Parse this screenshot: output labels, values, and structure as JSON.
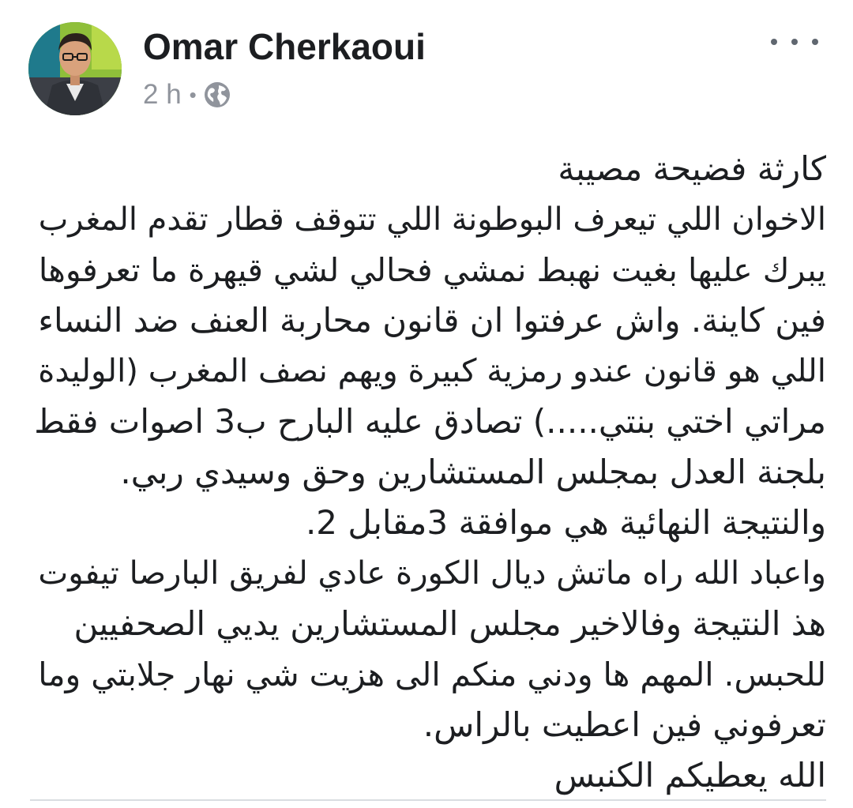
{
  "post": {
    "author": {
      "name": "Omar Cherkaoui",
      "avatar_icon": "profile-photo"
    },
    "meta": {
      "time": "2 h",
      "separator": "•",
      "privacy_icon": "globe-icon"
    },
    "more_options_icon": "more-horizontal-icon",
    "body_lines": [
      "كارثة فضيحة مصيبة",
      "الاخوان اللي تيعرف البوطونة اللي تتوقف قطار تقدم المغرب",
      "يبرك عليها بغيت نهبط نمشي فحالي لشي قيهرة ما تعرفوها",
      "فين كاينة. واش عرفتوا ان قانون محاربة العنف ضد النساء",
      "اللي هو قانون عندو رمزية كبيرة ويهم نصف المغرب (الوليدة",
      "مراتي اختي بنتي.....) تصادق عليه البارح ب3 اصوات فقط",
      "بلجنة العدل بمجلس المستشارين وحق وسيدي ربي.",
      "والنتيجة النهائية هي موافقة 3مقابل 2.",
      "واعباد الله راه ماتش ديال الكورة عادي لفريق البارصا تيفوت",
      "هذ النتيجة وفالاخير مجلس المستشارين يديي الصحفيين",
      "للحبس. المهم ها ودني منكم الى هزيت  شي نهار جلابتي وما",
      "تعرفوني فين اعطيت بالراس.",
      "الله يعطيكم الكنبس"
    ]
  }
}
